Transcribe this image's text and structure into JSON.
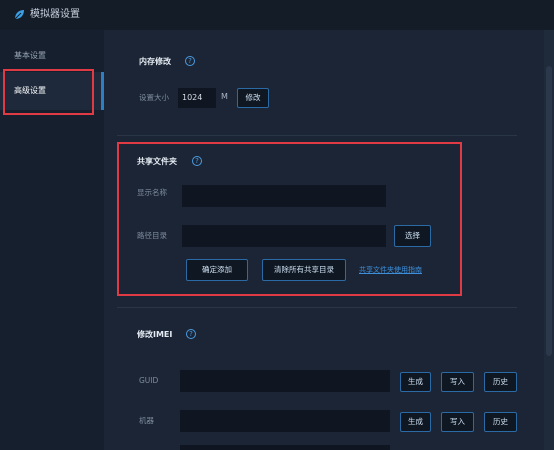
{
  "window": {
    "title": "模拟器设置",
    "icon": "leaf-icon"
  },
  "sidebar": {
    "items": [
      {
        "label": "基本设置"
      },
      {
        "label": "高级设置"
      }
    ]
  },
  "memory": {
    "title": "内存修改",
    "size_label": "设置大小",
    "size_value": "1024",
    "unit": "M",
    "apply_label": "修改"
  },
  "shared_folder": {
    "title": "共享文件夹",
    "display_name_label": "显示名称",
    "display_name_value": "",
    "path_label": "路径目录",
    "path_value": "",
    "browse_label": "选择",
    "confirm_label": "确定添加",
    "clear_label": "清除所有共享目录",
    "help_link": "共享文件夹使用指南"
  },
  "imei": {
    "title": "修改IMEI",
    "rows": [
      {
        "label": "GUID",
        "value": "",
        "generate": "生成",
        "write": "写入",
        "history": "历史"
      },
      {
        "label": "机器",
        "value": "",
        "generate": "生成",
        "write": "写入",
        "history": "历史"
      }
    ]
  },
  "colors": {
    "accent": "#2d7fc4",
    "highlight": "#e03a44",
    "background": "#1b2535"
  }
}
